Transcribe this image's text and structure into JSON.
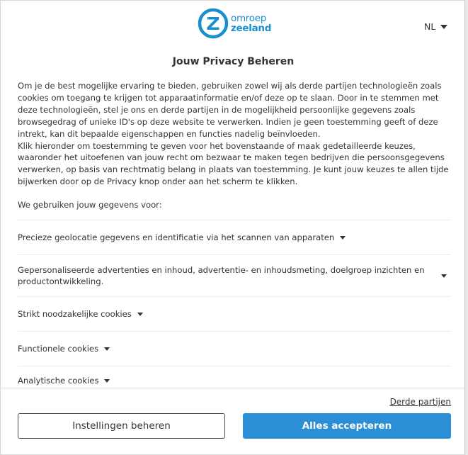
{
  "brand": {
    "logo_letter": "Z",
    "logo_line1": "omroep",
    "logo_line2": "zeeland",
    "color": "#1a8fd0"
  },
  "language": {
    "selected": "NL"
  },
  "title": "Jouw Privacy Beheren",
  "intro": {
    "paragraph1": "Om je de best mogelijke ervaring te bieden, gebruiken zowel wij als derde partijen technologieën zoals cookies om toegang te krijgen tot apparaatinformatie en/of deze op te slaan. Door in te stemmen met deze technologieën, stel je ons en derde partijen in de mogelijkheid persoonlijke gegevens zoals browsegedrag of unieke ID's op deze website te verwerken. Indien je geen toestemming geeft of deze intrekt, kan dit bepaalde eigenschappen en functies nadelig beïnvloeden.",
    "paragraph2": "Klik hieronder om toestemming te geven voor het bovenstaande of maak gedetailleerde keuzes, waaronder het uitoefenen van jouw recht om bezwaar te maken tegen bedrijven die persoonsgegevens verwerken, op basis van rechtmatig belang in plaats van toestemming. Je kunt jouw keuzes te allen tijde bijwerken door op de Privacy knop onder aan het scherm te klikken."
  },
  "uses_label": "We gebruiken jouw gegevens voor:",
  "purposes": [
    {
      "label": "Precieze geolocatie gegevens en identificatie via het scannen van apparaten"
    },
    {
      "label": "Gepersonaliseerde advertenties en inhoud, advertentie- en inhoudsmeting, doelgroep inzichten en productontwikkeling."
    },
    {
      "label": "Strikt noodzakelijke cookies"
    },
    {
      "label": "Functionele cookies"
    },
    {
      "label": "Analytische cookies"
    }
  ],
  "footer": {
    "third_parties": "Derde partijen",
    "manage_button": "Instellingen beheren",
    "accept_button": "Alles accepteren",
    "accept_color": "#2b8fd6"
  }
}
